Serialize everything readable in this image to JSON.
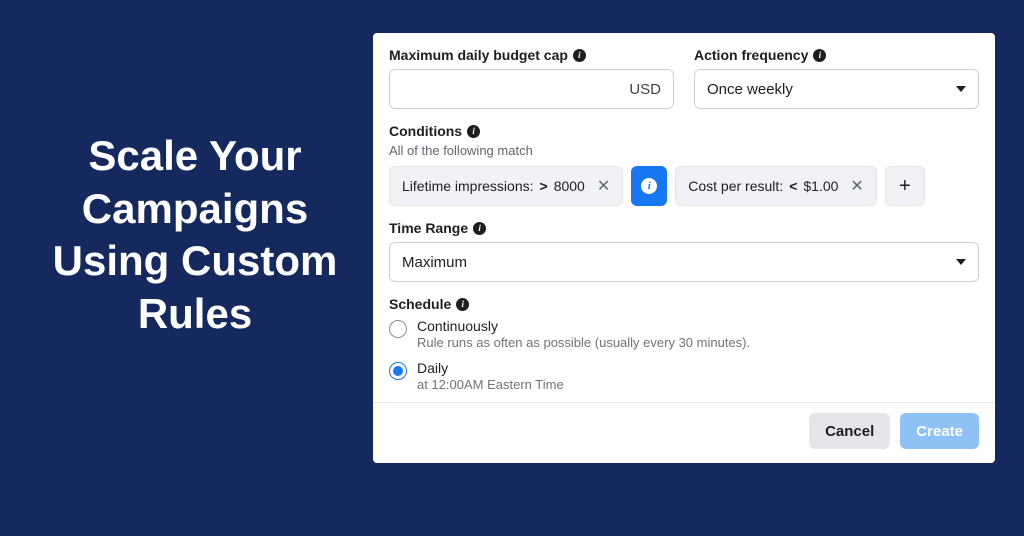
{
  "hero": {
    "title": "Scale Your Campaigns Using Custom Rules"
  },
  "budget": {
    "label": "Maximum daily budget cap",
    "currency": "USD"
  },
  "frequency": {
    "label": "Action frequency",
    "value": "Once weekly"
  },
  "conditions": {
    "label": "Conditions",
    "sub": "All of the following match",
    "items": [
      {
        "metric": "Lifetime impressions:",
        "op": ">",
        "value": "8000"
      },
      {
        "metric": "Cost per result:",
        "op": "<",
        "value": "$1.00"
      }
    ]
  },
  "timeRange": {
    "label": "Time Range",
    "value": "Maximum"
  },
  "schedule": {
    "label": "Schedule",
    "options": {
      "continuously": {
        "title": "Continuously",
        "desc": "Rule runs as often as possible (usually every 30 minutes)."
      },
      "daily": {
        "title": "Daily",
        "desc": "at 12:00AM Eastern Time"
      }
    }
  },
  "buttons": {
    "cancel": "Cancel",
    "create": "Create"
  }
}
